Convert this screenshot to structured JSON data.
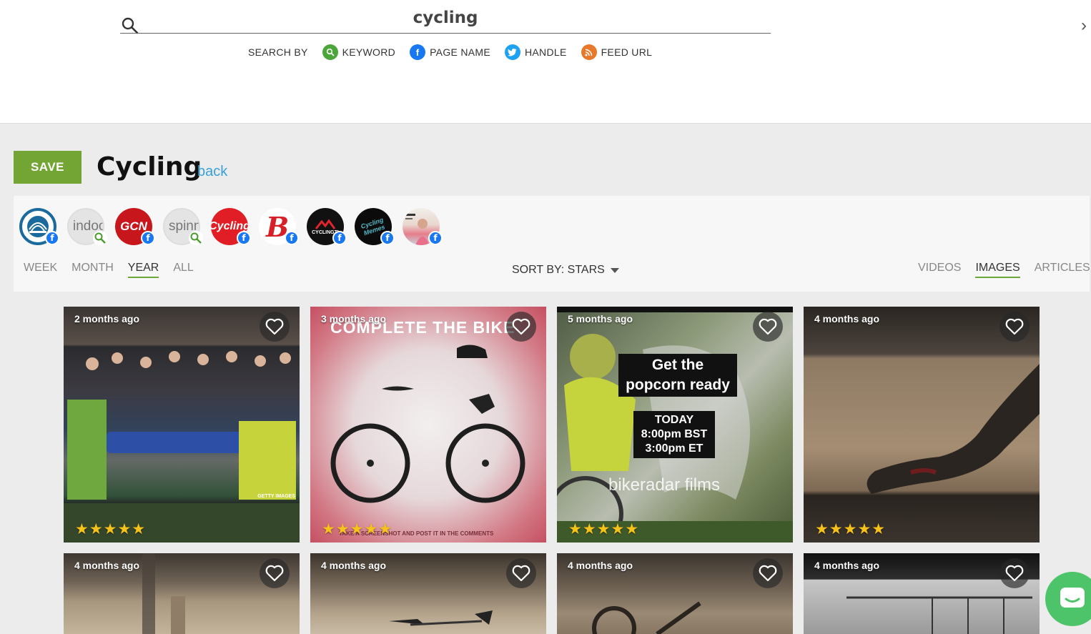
{
  "search": {
    "query": "cycling",
    "search_by_label": "SEARCH BY",
    "options": [
      {
        "label": "KEYWORD",
        "icon": "search-icon",
        "color": "#4ca53a"
      },
      {
        "label": "PAGE NAME",
        "icon": "facebook-icon",
        "color": "#1877f2"
      },
      {
        "label": "HANDLE",
        "icon": "twitter-icon",
        "color": "#1da1f2"
      },
      {
        "label": "FEED URL",
        "icon": "rss-icon",
        "color": "#e8792b"
      }
    ]
  },
  "header": {
    "save_label": "SAVE",
    "title": "Cycling",
    "back_label": "back"
  },
  "sources": [
    {
      "label": "",
      "type": "facebook"
    },
    {
      "label": "indoo",
      "type": "keyword"
    },
    {
      "label": "GCN",
      "type": "facebook"
    },
    {
      "label": "spinn",
      "type": "keyword"
    },
    {
      "label": "Cycling",
      "type": "facebook"
    },
    {
      "label": "B",
      "type": "facebook"
    },
    {
      "label": "CYCLINGTI",
      "type": "facebook"
    },
    {
      "label": "Cycling Memes",
      "type": "facebook"
    },
    {
      "label": "",
      "type": "facebook"
    }
  ],
  "time_tabs": [
    "WEEK",
    "MONTH",
    "YEAR",
    "ALL"
  ],
  "time_active": "YEAR",
  "sort": {
    "label": "SORT BY: STARS"
  },
  "type_tabs": [
    "VIDEOS",
    "IMAGES",
    "ARTICLES"
  ],
  "type_active": "IMAGES",
  "cards": [
    {
      "ago": "2 months ago",
      "stars": "★★★★★",
      "caption": "GETTY IMAGES"
    },
    {
      "ago": "3 months ago",
      "stars": "★★★★★",
      "caption": "COMPLETE THE BIKE",
      "footer": "TAKE A SCREENSHOT AND POST IT IN THE COMMENTS"
    },
    {
      "ago": "5 months ago",
      "stars": "★★★★★",
      "caption": "Get the popcorn ready",
      "line2": "TODAY",
      "line3": "8:00pm BST",
      "line4": "3:00pm ET",
      "brand": "bikeradar films"
    },
    {
      "ago": "4 months ago",
      "stars": "★★★★★"
    },
    {
      "ago": "4 months ago"
    },
    {
      "ago": "4 months ago"
    },
    {
      "ago": "4 months ago"
    },
    {
      "ago": "4 months ago"
    }
  ]
}
